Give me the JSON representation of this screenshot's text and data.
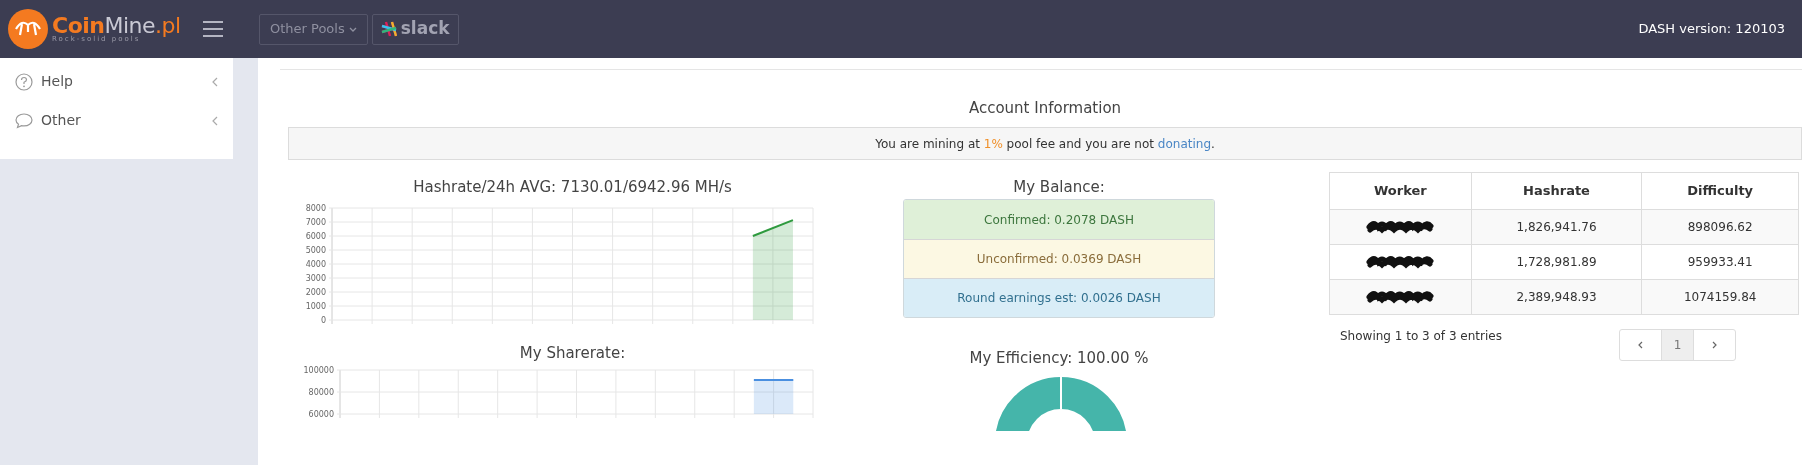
{
  "header": {
    "logo": {
      "parts": [
        {
          "text": "Coin",
          "kind": "bold"
        },
        {
          "text": "Mine",
          "kind": "light"
        },
        {
          "text": ".pl",
          "kind": "accent"
        }
      ],
      "tagline": "Rock-solid pools"
    },
    "buttons": [
      {
        "label": "Other Pools",
        "kind": "dropdown"
      },
      {
        "label": "slack",
        "kind": "slack"
      }
    ],
    "version": "DASH version: 120103"
  },
  "sidebar": {
    "items": [
      {
        "label": "Help",
        "kind": "help"
      },
      {
        "label": "Other",
        "kind": "chat"
      }
    ]
  },
  "account": {
    "title": "Account Information",
    "notice": [
      {
        "text": "You are mining at ",
        "kind": "plain"
      },
      {
        "text": "1%",
        "kind": "highlight"
      },
      {
        "text": " pool fee and you are not ",
        "kind": "plain"
      },
      {
        "text": "donating",
        "kind": "link"
      },
      {
        "text": ".",
        "kind": "plain"
      }
    ]
  },
  "hashrate": {
    "title": "Hashrate/24h AVG: 7130.01/6942.96 MH/s",
    "chart_data": {
      "type": "area",
      "grid": true,
      "categories": [
        null,
        null,
        null,
        null,
        null,
        null,
        null,
        null,
        null,
        null,
        null,
        null
      ],
      "ylim": [
        0,
        8000
      ],
      "yticks": [
        0,
        1000,
        2000,
        3000,
        4000,
        5000,
        6000,
        7000,
        8000
      ],
      "series": [
        {
          "color": "#2e9a3e",
          "values": [
            null,
            null,
            null,
            null,
            null,
            null,
            null,
            null,
            null,
            null,
            6000,
            7130
          ]
        }
      ]
    }
  },
  "sharerate": {
    "title": "My Sharerate:",
    "chart_data": {
      "type": "area",
      "grid": true,
      "categories": [
        null,
        null,
        null,
        null,
        null,
        null,
        null,
        null,
        null,
        null,
        null,
        null
      ],
      "ylim": [
        60000,
        100000
      ],
      "yticks": [
        60000,
        80000,
        100000
      ],
      "series": [
        {
          "color": "#4a8fe0",
          "values": [
            null,
            null,
            null,
            null,
            null,
            null,
            null,
            null,
            null,
            null,
            91000,
            91000
          ]
        }
      ]
    }
  },
  "balance": {
    "title": "My Balance:",
    "rows": [
      {
        "text": "Confirmed: 0.2078 DASH",
        "kind": "success"
      },
      {
        "text": "Unconfirmed: 0.0369 DASH",
        "kind": "warning"
      },
      {
        "text": "Round earnings est: 0.0026 DASH",
        "kind": "info"
      }
    ]
  },
  "efficiency": {
    "title": "My Efficiency: 100.00 %"
  },
  "workers": {
    "columns": [
      "Worker",
      "Hashrate",
      "Difficulty"
    ],
    "rows": [
      {
        "worker_redacted": true,
        "hashrate": "1,826,941.76",
        "difficulty": "898096.62"
      },
      {
        "worker_redacted": true,
        "hashrate": "1,728,981.89",
        "difficulty": "959933.41"
      },
      {
        "worker_redacted": true,
        "hashrate": "2,389,948.93",
        "difficulty": "1074159.84"
      }
    ],
    "info": "Showing 1 to 3 of 3 entries",
    "pages": [
      {
        "label": "1",
        "selected": true
      }
    ]
  }
}
